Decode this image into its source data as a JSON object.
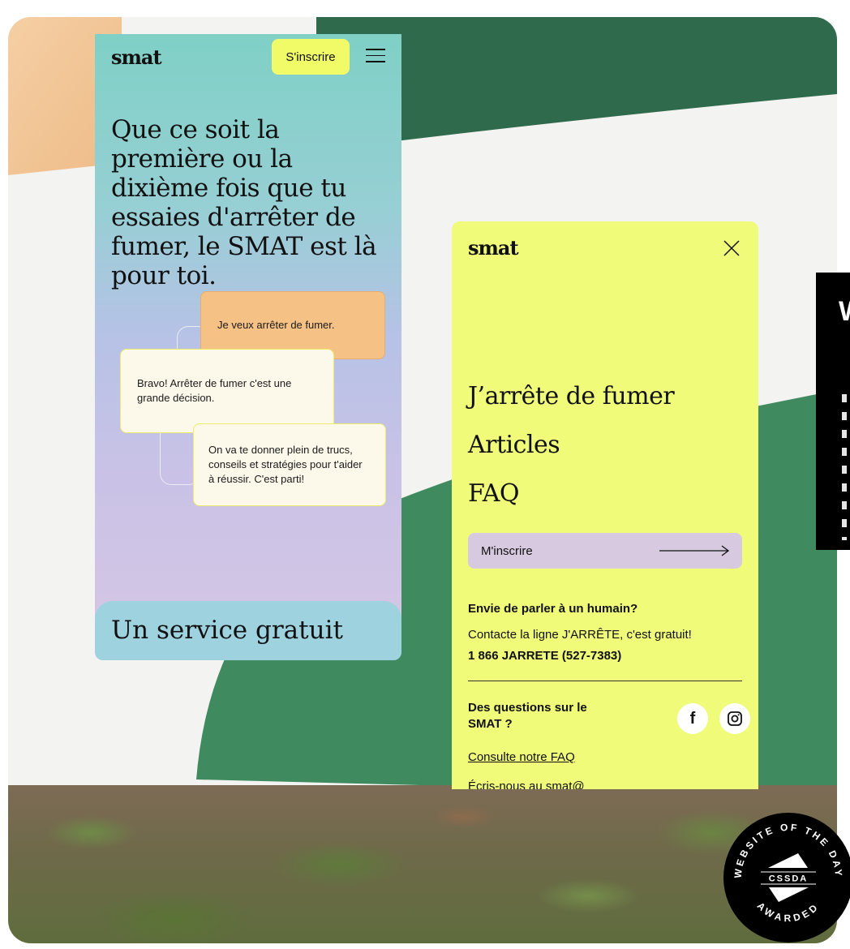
{
  "left_phone": {
    "logo": "smat",
    "cta": "S'inscrire",
    "hero": "Que ce soit la première ou la dixième fois que tu essaies d'arrêter de fumer, le SMAT est là pour toi.",
    "chat": [
      "Je veux arrêter de fumer.",
      "Bravo! Arrêter de fumer c'est une grande décision.",
      "On va te donner plein de trucs, conseils et stratégies pour t'aider à réussir. C'est parti!"
    ],
    "next_section": "Un service gratuit"
  },
  "right_phone": {
    "logo": "smat",
    "nav": [
      "J’arrête de fumer",
      "Articles",
      "FAQ"
    ],
    "signup": "M'inscrire",
    "human_heading": "Envie de parler à un humain?",
    "human_text": "Contacte la ligne J'ARRÊTE, c'est gratuit!",
    "phone": "1 866 JARRETE (527-7383)",
    "questions_heading": "Des questions sur le SMAT ?",
    "faq_link": "Consulte notre FAQ",
    "cut_text": "Écris-nous au smat@"
  },
  "badge": {
    "top": "WEBSITE OF THE DAY",
    "center": "CSSDA",
    "bottom": "AWARDED"
  },
  "colors": {
    "yellow": "#f0fb7a",
    "green_dark": "#2f6a4c",
    "green": "#3e8a5c",
    "peach": "#f3c79a",
    "lavender": "#d6c9e0"
  }
}
